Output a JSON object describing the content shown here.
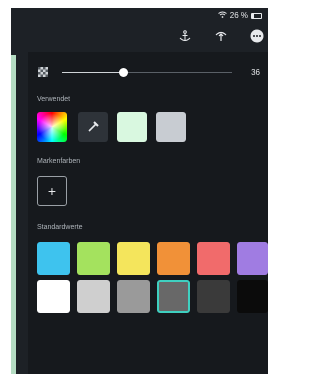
{
  "status_bar": {
    "battery_text": "26 %"
  },
  "toolbar": {
    "icons": [
      "anchor-icon",
      "share-icon",
      "more-icon"
    ]
  },
  "transparency": {
    "value": "36",
    "level": 0.36
  },
  "sections": {
    "used_label": "Verwendet",
    "brand_label": "Markenfarben",
    "default_label": "Standardwerte"
  },
  "used_colors": [
    {
      "kind": "rainbow",
      "name": "color-picker"
    },
    {
      "kind": "eyedropper",
      "name": "eyedropper"
    },
    {
      "kind": "color",
      "color": "#d9f8e0"
    },
    {
      "kind": "color",
      "color": "#c8ccd2"
    }
  ],
  "brand_add_label": "+",
  "default_colors": {
    "row1": [
      "#3ec3ee",
      "#a4e25e",
      "#f4e55c",
      "#f19138",
      "#f16b6b",
      "#a07ce2"
    ],
    "row2": [
      "#ffffff",
      "#cfcfcf",
      "#9a9a9a",
      "#686868",
      "#3a3a3a",
      "#0b0b0b"
    ]
  },
  "colors": {
    "background": "#1d2126",
    "panel": "#16191d",
    "accent_strip": "#b5ddc3",
    "selected_border": "#3fd0c0"
  }
}
